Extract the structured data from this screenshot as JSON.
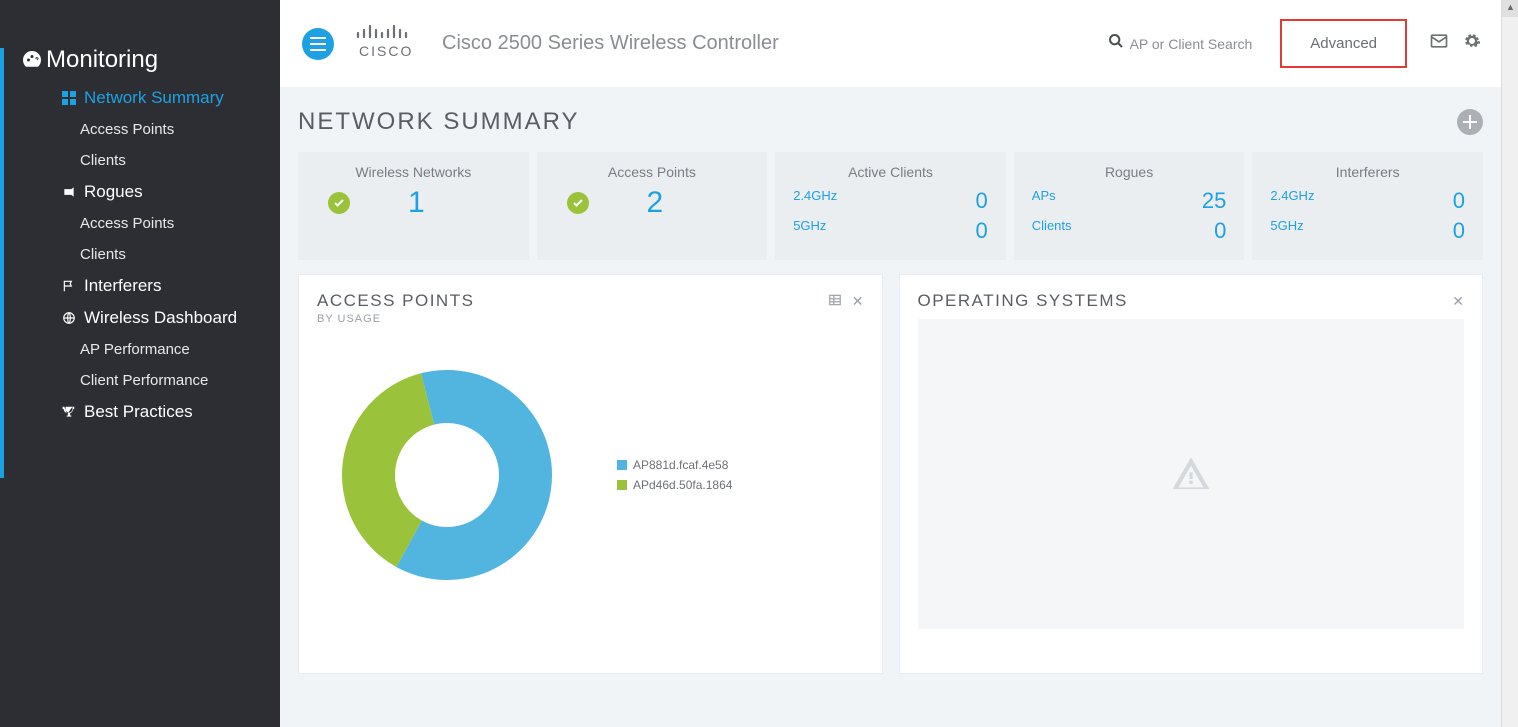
{
  "sidebar": {
    "title": "Monitoring",
    "sections": [
      {
        "label": "Network Summary",
        "active": true,
        "children": [
          "Access Points",
          "Clients"
        ]
      },
      {
        "label": "Rogues",
        "children": [
          "Access Points",
          "Clients"
        ]
      },
      {
        "label": "Interferers",
        "children": []
      },
      {
        "label": "Wireless Dashboard",
        "children": [
          "AP Performance",
          "Client Performance"
        ]
      },
      {
        "label": "Best Practices",
        "children": []
      }
    ]
  },
  "header": {
    "product": "Cisco 2500 Series Wireless Controller",
    "search_placeholder": "AP or Client Search",
    "advanced": "Advanced"
  },
  "page": {
    "title": "NETWORK SUMMARY"
  },
  "stats": {
    "wireless_networks": {
      "title": "Wireless Networks",
      "value": "1"
    },
    "access_points": {
      "title": "Access Points",
      "value": "2"
    },
    "active_clients": {
      "title": "Active Clients",
      "rows": [
        {
          "lbl": "2.4GHz",
          "val": "0"
        },
        {
          "lbl": "5GHz",
          "val": "0"
        }
      ]
    },
    "rogues": {
      "title": "Rogues",
      "rows": [
        {
          "lbl": "APs",
          "val": "25"
        },
        {
          "lbl": "Clients",
          "val": "0"
        }
      ]
    },
    "interferers": {
      "title": "Interferers",
      "rows": [
        {
          "lbl": "2.4GHz",
          "val": "0"
        },
        {
          "lbl": "5GHz",
          "val": "0"
        }
      ]
    }
  },
  "widgets": {
    "ap": {
      "title": "ACCESS POINTS",
      "subtitle": "BY USAGE"
    },
    "os": {
      "title": "OPERATING SYSTEMS"
    }
  },
  "chart_data": {
    "type": "pie",
    "title": "Access Points by Usage",
    "series": [
      {
        "name": "AP881d.fcaf.4e58",
        "value": 62,
        "color": "#51b5e0"
      },
      {
        "name": "APd46d.50fa.1864",
        "value": 38,
        "color": "#9ac33b"
      }
    ]
  }
}
